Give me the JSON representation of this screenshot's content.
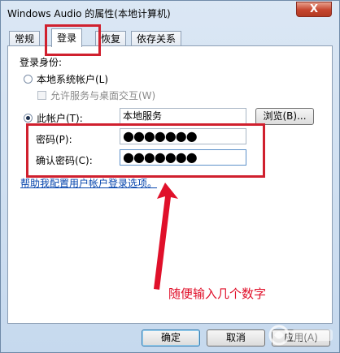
{
  "window": {
    "title": "Windows Audio 的属性(本地计算机)",
    "close_glyph": "X"
  },
  "tabs": [
    {
      "label": "常规",
      "active": false
    },
    {
      "label": "登录",
      "active": true
    },
    {
      "label": "恢复",
      "active": false
    },
    {
      "label": "依存关系",
      "active": false
    }
  ],
  "logon": {
    "section_label": "登录身份:",
    "local_system_label": "本地系统帐户(L)",
    "allow_desktop_label": "允许服务与桌面交互(W)",
    "this_account_label": "此帐户(T):",
    "account_value": "本地服务",
    "browse_label": "浏览(B)...",
    "password_label": "密码(P):",
    "password_value": "●●●●●●●",
    "confirm_label": "确认密码(C):",
    "confirm_value": "●●●●●●●",
    "help_link": "帮助我配置用户帐户登录选项。"
  },
  "annotation": {
    "text": "随便输入几个数字",
    "color": "#e0102a"
  },
  "footer": {
    "ok_label": "确定",
    "cancel_label": "取消",
    "apply_label": "应用(A)"
  },
  "colors": {
    "highlight": "#d0202e",
    "link": "#0645ad"
  }
}
